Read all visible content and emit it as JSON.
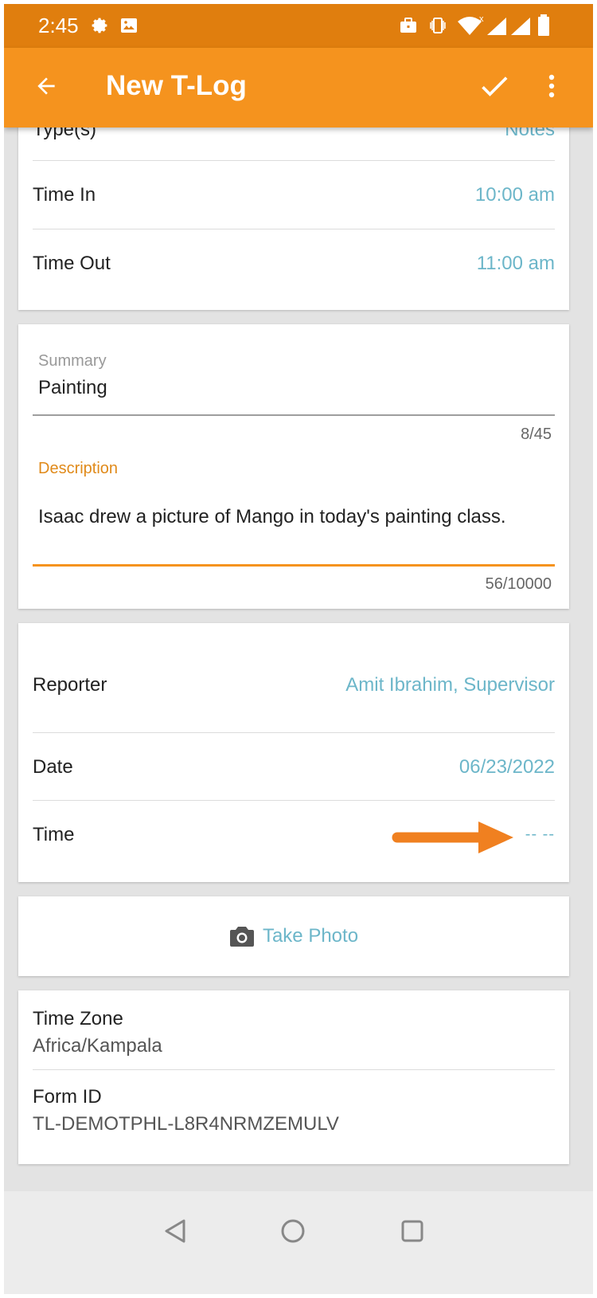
{
  "status_bar": {
    "time": "2:45"
  },
  "app_bar": {
    "title": "New T-Log"
  },
  "card_times": {
    "type_label": "Type(s)",
    "type_value": "Notes",
    "time_in_label": "Time In",
    "time_in_value": "10:00 am",
    "time_out_label": "Time Out",
    "time_out_value": "11:00 am"
  },
  "card_summary": {
    "summary_label": "Summary",
    "summary_value": "Painting",
    "summary_counter": "8/45",
    "description_label": "Description",
    "description_value": "Isaac drew a picture of Mango in today's painting class.",
    "description_counter": "56/10000"
  },
  "card_reporter": {
    "reporter_label": "Reporter",
    "reporter_value": "Amit Ibrahim, Supervisor",
    "date_label": "Date",
    "date_value": "06/23/2022",
    "time_label": "Time",
    "time_value": "-- --"
  },
  "card_photo": {
    "take_photo_label": "Take Photo"
  },
  "card_info": {
    "timezone_label": "Time Zone",
    "timezone_value": "Africa/Kampala",
    "formid_label": "Form ID",
    "formid_value": "TL-DEMOTPHL-L8R4NRMZEMULV"
  },
  "colors": {
    "status_bar": "#e07e0e",
    "app_bar": "#f5931e",
    "accent": "#f5931e",
    "value_text": "#6cb6c9",
    "annotation_arrow": "#f08020"
  },
  "icons": [
    "gear-icon",
    "image-icon",
    "briefcase-icon",
    "vibrate-icon",
    "wifi-icon",
    "signal-icon",
    "battery-icon",
    "back-arrow-icon",
    "check-icon",
    "more-vert-icon",
    "camera-icon",
    "nav-back-icon",
    "nav-home-icon",
    "nav-recents-icon"
  ]
}
